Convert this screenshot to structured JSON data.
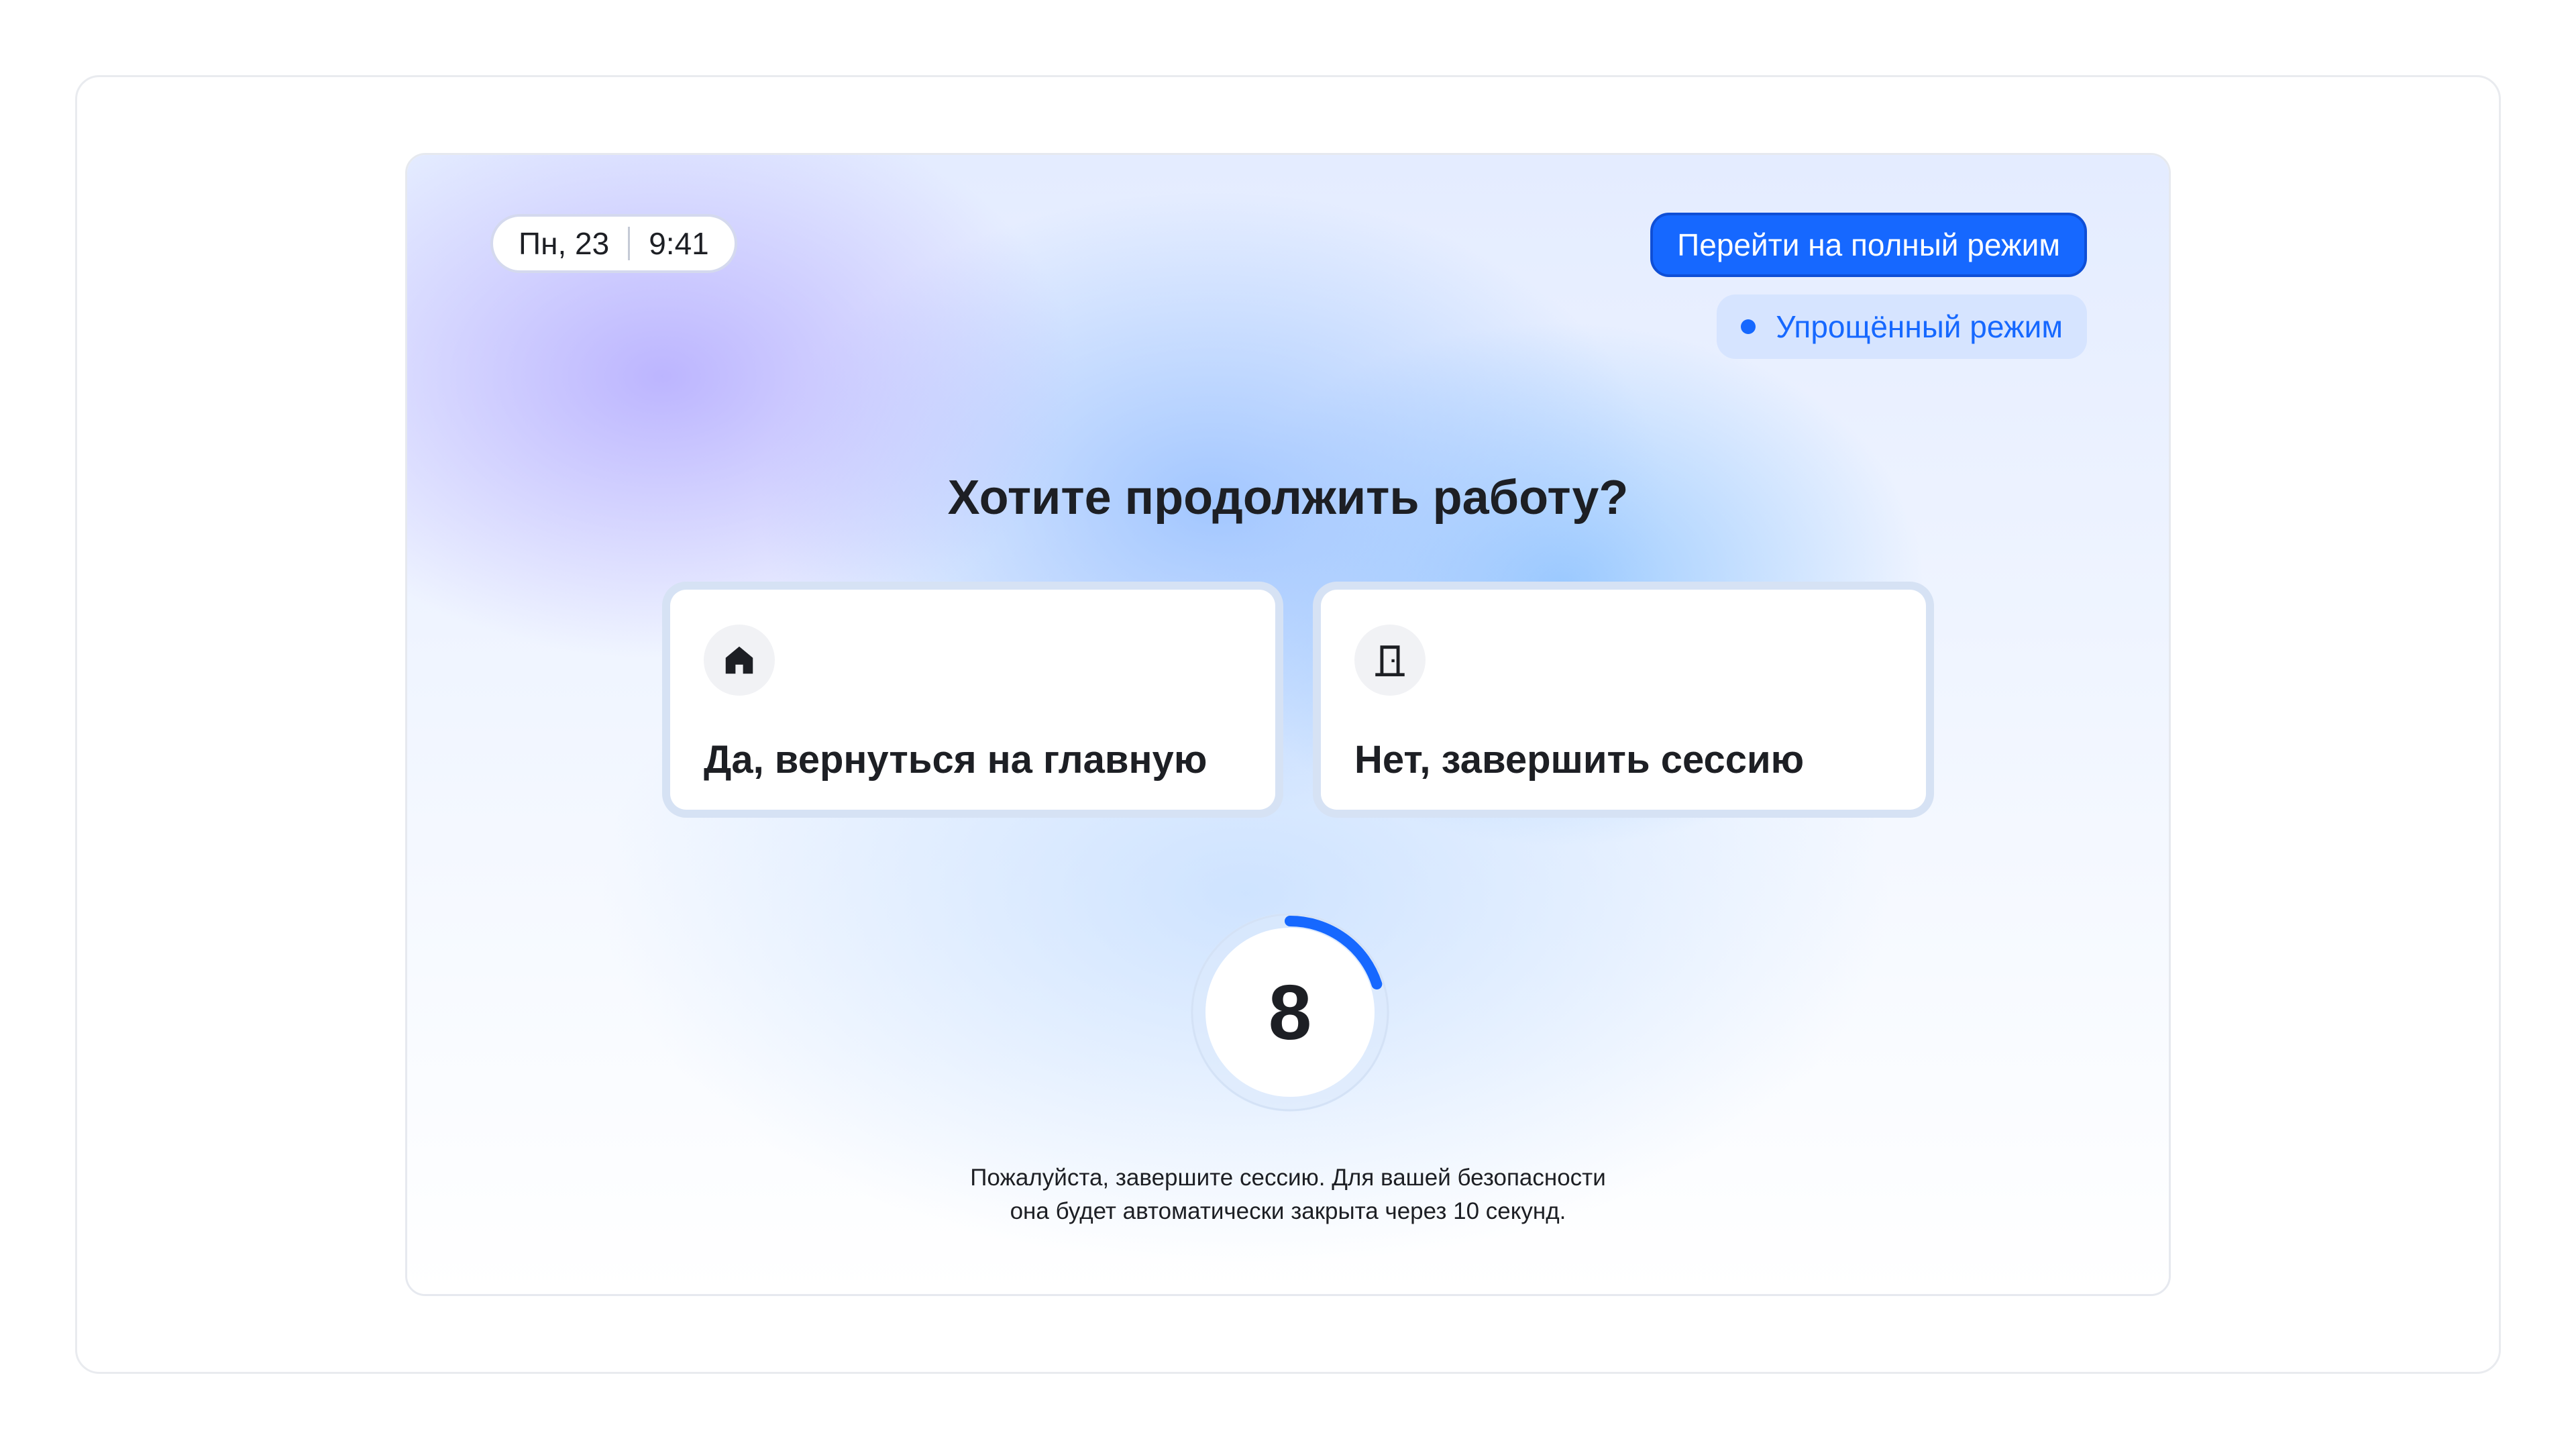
{
  "header": {
    "date": "Пн, 23",
    "time": "9:41",
    "full_mode_button": "Перейти на полный режим",
    "simple_mode_badge": "Упрощённый режим"
  },
  "dialog": {
    "question": "Хотите продолжить работу?",
    "options": [
      {
        "label": "Да, вернуться на главную",
        "icon": "home-icon"
      },
      {
        "label": "Нет, завершить сессию",
        "icon": "door-icon"
      }
    ]
  },
  "timer": {
    "seconds_left": "8",
    "progress_fraction": 0.2
  },
  "notice": {
    "line1": "Пожалуйста, завершите сессию. Для вашей безопасности",
    "line2": "она будет автоматически закрыта через 10 секунд."
  },
  "colors": {
    "accent": "#1668ff",
    "text": "#1d1f24"
  }
}
